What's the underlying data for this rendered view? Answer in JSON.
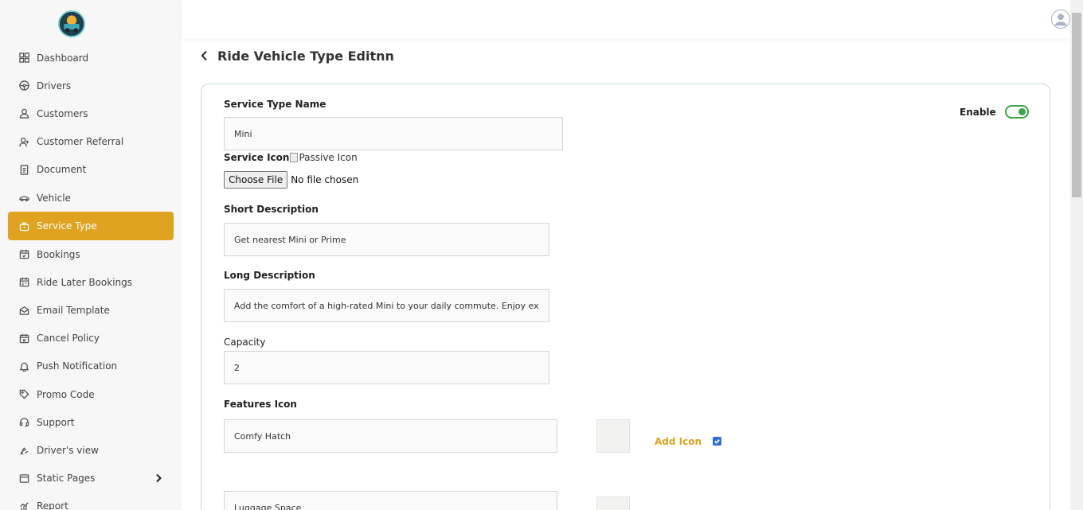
{
  "sidebar": {
    "items": [
      {
        "label": "Dashboard",
        "icon": "grid-icon",
        "active": false
      },
      {
        "label": "Drivers",
        "icon": "steering-wheel-icon",
        "active": false
      },
      {
        "label": "Customers",
        "icon": "user-icon",
        "active": false
      },
      {
        "label": "Customer Referral",
        "icon": "user-plus-icon",
        "active": false
      },
      {
        "label": "Document",
        "icon": "document-icon",
        "active": false
      },
      {
        "label": "Vehicle",
        "icon": "car-icon",
        "active": false
      },
      {
        "label": "Service Type",
        "icon": "briefcase-icon",
        "active": true
      },
      {
        "label": "Bookings",
        "icon": "calendar-icon",
        "active": false
      },
      {
        "label": "Ride Later Bookings",
        "icon": "calendar-clock-icon",
        "active": false
      },
      {
        "label": "Email Template",
        "icon": "envelope-icon",
        "active": false
      },
      {
        "label": "Cancel Policy",
        "icon": "calendar-x-icon",
        "active": false
      },
      {
        "label": "Push Notification",
        "icon": "bell-icon",
        "active": false
      },
      {
        "label": "Promo Code",
        "icon": "tag-icon",
        "active": false
      },
      {
        "label": "Support",
        "icon": "headset-icon",
        "active": false
      },
      {
        "label": "Driver's view",
        "icon": "driver-view-icon",
        "active": false
      },
      {
        "label": "Static Pages",
        "icon": "browser-window-icon",
        "active": false
      },
      {
        "label": "Report",
        "icon": "report-chart-icon",
        "active": false
      }
    ]
  },
  "page": {
    "title": "Ride Vehicle Type Editnn"
  },
  "form": {
    "enable_label": "Enable",
    "enabled": true,
    "service_type_name_label": "Service Type Name",
    "service_type_name_value": "Mini",
    "service_icon_label": "Service Icon",
    "service_icon_alt": "Passive Icon",
    "choose_file_label": "Choose File",
    "file_status": "No file chosen",
    "short_description_label": "Short Description",
    "short_description_value": "Get nearest Mini or Prime",
    "long_description_label": "Long Description",
    "long_description_value": "Add the comfort of a high-rated Mini to your daily commute. Enjoy extra legroom and spacious boot.",
    "capacity_label": "Capacity",
    "capacity_value": "2",
    "features_icon_label": "Features Icon",
    "features": [
      {
        "value": "Comfy Hatch",
        "checked": true
      },
      {
        "value": "Luggage Space",
        "checked": false
      }
    ],
    "add_icon_label": "Add Icon"
  },
  "colors": {
    "accent": "#dfa320",
    "toggle": "#3aa64b",
    "checkbox": "#2f6fe0"
  }
}
